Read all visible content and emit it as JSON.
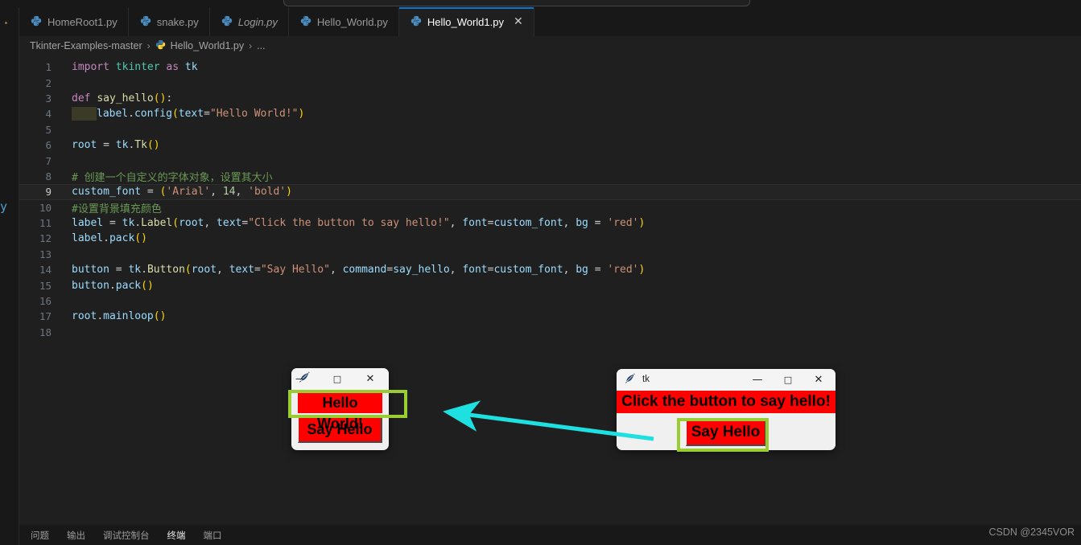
{
  "window": {
    "title_search_placeholder": ""
  },
  "tabs": [
    {
      "label": "HomeRoot1.py",
      "icon": "python-icon",
      "active": false,
      "italic": false,
      "closable": false
    },
    {
      "label": "snake.py",
      "icon": "python-icon",
      "active": false,
      "italic": false,
      "closable": false
    },
    {
      "label": "Login.py",
      "icon": "python-icon",
      "active": false,
      "italic": true,
      "closable": false
    },
    {
      "label": "Hello_World.py",
      "icon": "python-icon",
      "active": false,
      "italic": false,
      "closable": false
    },
    {
      "label": "Hello_World1.py",
      "icon": "python-icon",
      "active": true,
      "italic": false,
      "closable": true,
      "close_label": "✕"
    }
  ],
  "breadcrumb": {
    "items": [
      "Tkinter-Examples-master",
      "Hello_World1.py",
      "..."
    ],
    "separator": "›"
  },
  "editor": {
    "active_line": 9,
    "lines": [
      {
        "n": "1",
        "type": "import"
      },
      {
        "n": "2",
        "type": "blank"
      },
      {
        "n": "3",
        "type": "def"
      },
      {
        "n": "4",
        "type": "config"
      },
      {
        "n": "5",
        "type": "blank"
      },
      {
        "n": "6",
        "type": "root"
      },
      {
        "n": "7",
        "type": "blank"
      },
      {
        "n": "8",
        "type": "comment1"
      },
      {
        "n": "9",
        "type": "font"
      },
      {
        "n": "10",
        "type": "comment2"
      },
      {
        "n": "11",
        "type": "label"
      },
      {
        "n": "12",
        "type": "labelpack"
      },
      {
        "n": "13",
        "type": "blank"
      },
      {
        "n": "14",
        "type": "button"
      },
      {
        "n": "15",
        "type": "buttonpack"
      },
      {
        "n": "16",
        "type": "blank"
      },
      {
        "n": "17",
        "type": "mainloop"
      },
      {
        "n": "18",
        "type": "blank"
      }
    ],
    "source": [
      "import tkinter as tk",
      "",
      "def say_hello():",
      "    label.config(text=\"Hello World!\")",
      "",
      "root = tk.Tk()",
      "",
      "# 创建一个自定义的字体对象，设置其大小",
      "custom_font = ('Arial', 14, 'bold')",
      "#设置背景填充颜色",
      "label = tk.Label(root, text=\"Click the button to say hello!\", font=custom_font, bg = 'red')",
      "label.pack()",
      "",
      "button = tk.Button(root, text=\"Say Hello\", command=say_hello, font=custom_font, bg = 'red')",
      "button.pack()",
      "",
      "root.mainloop()",
      ""
    ],
    "tokens": {
      "import_kw": "import",
      "module_tkinter": "tkinter",
      "as_kw": "as",
      "alias_tk": "tk",
      "def_kw": "def",
      "fn_say_hello": "say_hello",
      "paren_empty_colon": "():",
      "var_label": "label",
      "dot": ".",
      "attr_config": "config",
      "kw_text": "text",
      "eq": "=",
      "str_hello_world": "\"Hello World!\"",
      "var_root": "root",
      "assign": " = ",
      "mod_tk": "tk",
      "cls_Tk": "Tk",
      "comment_1": "# 创建一个自定义的字体对象，设置其大小",
      "var_custom_font": "custom_font",
      "str_arial": "'Arial'",
      "num_14": "14",
      "str_bold": "'bold'",
      "comment_2": "#设置背景填充颜色",
      "cls_Label": "Label",
      "str_click": "\"Click the button to say hello!\"",
      "kw_font": "font",
      "kw_bg": "bg",
      "str_red": "'red'",
      "attr_pack": "pack",
      "var_button": "button",
      "cls_Button": "Button",
      "str_say_hello": "\"Say Hello\"",
      "kw_command": "command",
      "attr_mainloop": "mainloop"
    }
  },
  "tk_windows": [
    {
      "id": "left",
      "title": "",
      "icon": "feather-icon",
      "minimize": "—",
      "maximize": "□",
      "close": "✕",
      "label_text": "Hello World!",
      "button_text": "Say Hello",
      "bg_color": "#ff0000",
      "highlight_color": "#9acd32",
      "highlighted": "label"
    },
    {
      "id": "right",
      "title": "tk",
      "icon": "feather-icon",
      "minimize": "—",
      "maximize": "□",
      "close": "✕",
      "label_text": "Click the button to say hello!",
      "button_text": "Say Hello",
      "bg_color": "#ff0000",
      "highlight_color": "#9acd32",
      "highlighted": "button"
    }
  ],
  "annotation": {
    "arrow_color": "#1ee0e0",
    "direction": "right-to-left"
  },
  "panel": {
    "tabs": [
      {
        "label": "问题",
        "active": false
      },
      {
        "label": "输出",
        "active": false
      },
      {
        "label": "调试控制台",
        "active": false
      },
      {
        "label": "终端",
        "active": true
      },
      {
        "label": "端口",
        "active": false
      }
    ]
  },
  "watermark": {
    "text": "CSDN @2345VOR"
  },
  "colors": {
    "editor_bg": "#1f1f1f",
    "chrome_bg": "#181818",
    "accent": "#0078d4",
    "tk_red": "#ff0000",
    "highlight_green": "#9acd32",
    "arrow_cyan": "#1ee0e0"
  }
}
